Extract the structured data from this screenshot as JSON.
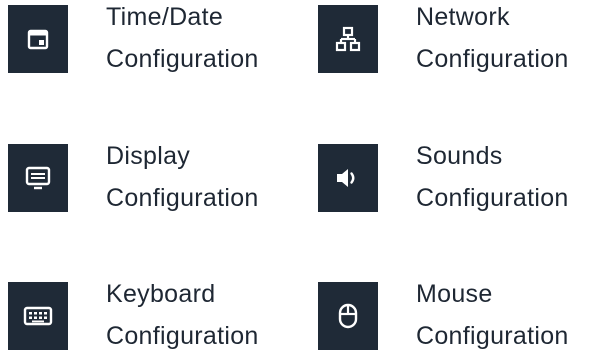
{
  "colors": {
    "tile_background": "#1f2a37",
    "icon": "#ffffff",
    "text": "#1e2733",
    "page_background": "#ffffff"
  },
  "items": [
    {
      "title": "Time/Date",
      "subtitle": "Configuration",
      "icon": "calendar-icon"
    },
    {
      "title": "Network",
      "subtitle": "Configuration",
      "icon": "network-icon"
    },
    {
      "title": "Display",
      "subtitle": "Configuration",
      "icon": "display-icon"
    },
    {
      "title": "Sounds",
      "subtitle": "Configuration",
      "icon": "speaker-icon"
    },
    {
      "title": "Keyboard",
      "subtitle": "Configuration",
      "icon": "keyboard-icon"
    },
    {
      "title": "Mouse",
      "subtitle": "Configuration",
      "icon": "mouse-icon"
    }
  ]
}
